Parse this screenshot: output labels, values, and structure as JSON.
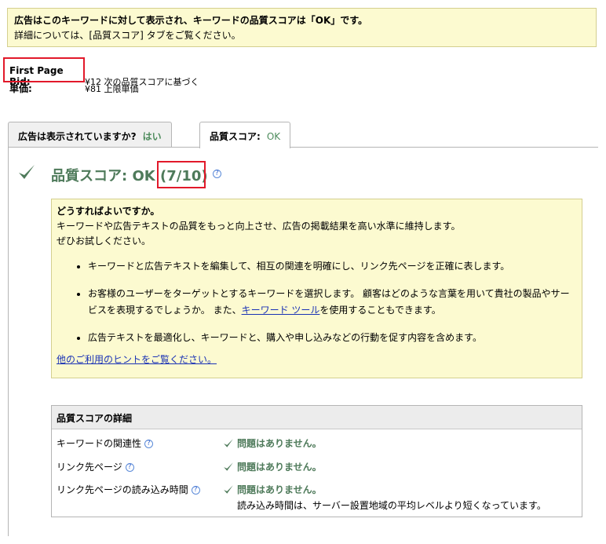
{
  "notice": {
    "line1": "広告はこのキーワードに対して表示され、キーワードの品質スコアは「OK」です。",
    "line2": "詳細については、[品質スコア] タブをご覧ください。"
  },
  "bids": {
    "first_page_label": "First Page Bid:",
    "first_page_value": "¥12 次の品質スコアに基づく",
    "unit_label": "単価:",
    "unit_value": "¥81 上限単価"
  },
  "tabs": [
    {
      "label": "広告は表示されていますか?",
      "value": "はい"
    },
    {
      "label": "品質スコア:",
      "value": "OK"
    }
  ],
  "quality": {
    "title": "品質スコア: OK",
    "score": "(7/10)",
    "help": "?"
  },
  "tips": {
    "heading": "どうすればよいですか。",
    "intro1": "キーワードや広告テキストの品質をもっと向上させ、広告の掲載結果を高い水準に維持します。",
    "intro2": "ぜひお試しください。",
    "bullet1": "キーワードと広告テキストを編集して、相互の関連を明確にし、リンク先ページを正確に表します。",
    "bullet2_a": "お客様のユーザーをターゲットとするキーワードを選択します。 顧客はどのような言葉を用いて貴社の製品やサービスを表現するでしょうか。 また、",
    "bullet2_link": "キーワード ツール",
    "bullet2_b": "を使用することもできます。",
    "bullet3": "広告テキストを最適化し、キーワードと、購入や申し込みなどの行動を促す内容を含めます。",
    "more_link": "他のご利用のヒントをご覧ください。"
  },
  "details": {
    "heading": "品質スコアの詳細",
    "rows": [
      {
        "label": "キーワードの関連性",
        "status": "問題はありません。"
      },
      {
        "label": "リンク先ページ",
        "status": "問題はありません。"
      },
      {
        "label": "リンク先ページの読み込み時間",
        "status": "問題はありません。",
        "note": "読み込み時間は、サーバー設置地域の平均レベルより短くなっています。"
      }
    ]
  },
  "colors": {
    "accent_green": "#4e7a5a",
    "highlight_red": "#e2192a",
    "notice_bg": "#fcfad0",
    "link": "#1a32b5"
  }
}
